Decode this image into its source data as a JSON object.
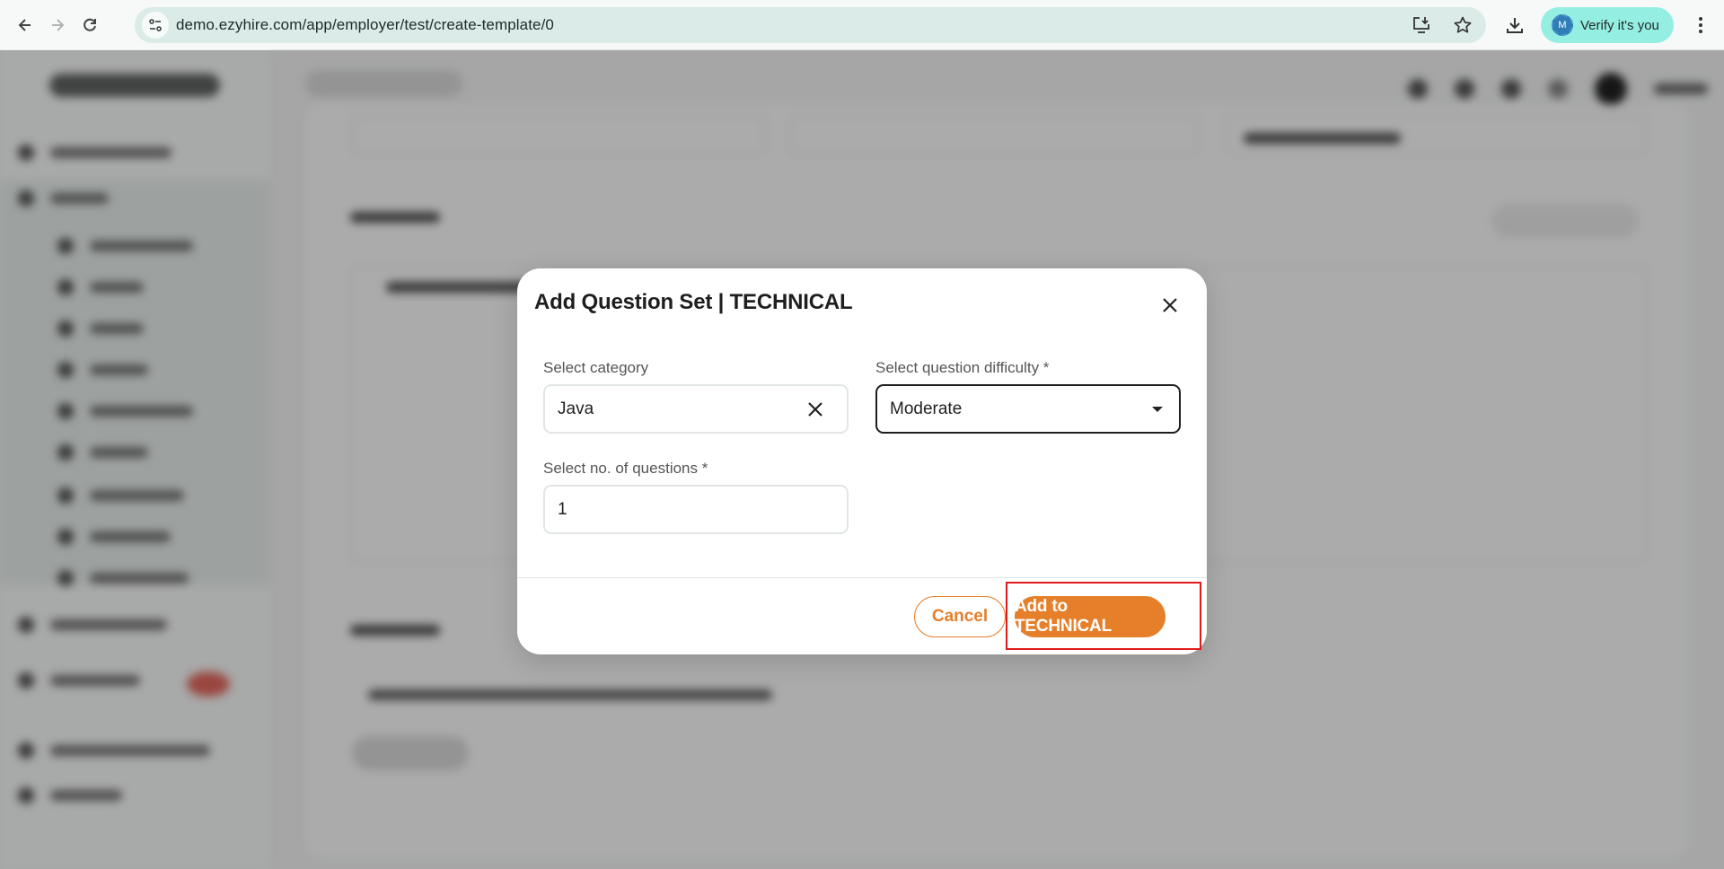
{
  "browser": {
    "url": "demo.ezyhire.com/app/employer/test/create-template/0",
    "verify_label": "Verify it's you",
    "profile_initial": "M",
    "icons": {
      "back": "arrow-left",
      "forward": "arrow-right",
      "reload": "reload",
      "site_info": "tune",
      "install_app": "install-desktop",
      "bookmark": "star",
      "downloads": "download",
      "menu": "kebab-menu"
    }
  },
  "modal": {
    "title": "Add Question Set | TECHNICAL",
    "category": {
      "label": "Select category",
      "value": "Java"
    },
    "difficulty": {
      "label": "Select question difficulty *",
      "value": "Moderate"
    },
    "count": {
      "label": "Select no. of questions *",
      "value": "1"
    },
    "cancel_label": "Cancel",
    "submit_label": "Add to TECHNICAL"
  },
  "colors": {
    "accent": "#e67f2a",
    "highlight": "#e0191c",
    "verify_pill": "#95eee2",
    "omnibox": "#dbece8"
  }
}
